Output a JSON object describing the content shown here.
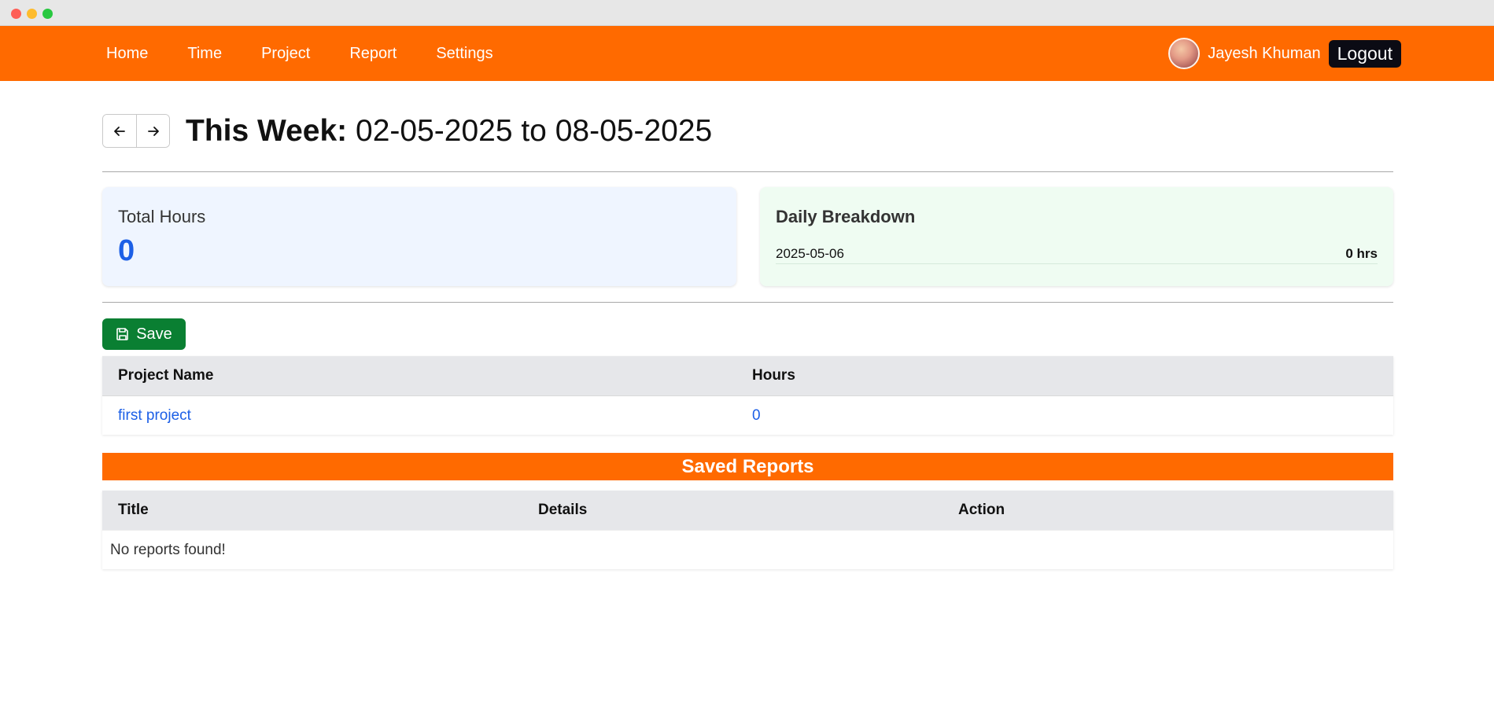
{
  "nav": {
    "links": [
      "Home",
      "Time",
      "Project",
      "Report",
      "Settings"
    ],
    "user_name": "Jayesh Khuman",
    "logout_label": "Logout"
  },
  "week": {
    "label": "This Week:",
    "range": "02-05-2025 to 08-05-2025",
    "prev_icon": "arrow-left-icon",
    "next_icon": "arrow-right-icon"
  },
  "summary": {
    "total_label": "Total Hours",
    "total_value": "0",
    "daily_title": "Daily Breakdown",
    "daily_rows": [
      {
        "date": "2025-05-06",
        "hours": "0 hrs"
      }
    ]
  },
  "projects": {
    "save_label": "Save",
    "save_icon": "floppy-disk-icon",
    "headers": [
      "Project Name",
      "Hours"
    ],
    "rows": [
      {
        "name": "first project",
        "hours": "0"
      }
    ]
  },
  "reports": {
    "title": "Saved Reports",
    "headers": [
      "Title",
      "Details",
      "Action"
    ],
    "empty_text": "No reports found!"
  },
  "colors": {
    "brand": "#ff6a00",
    "accent": "#1c5fe6",
    "save": "#0a7f32"
  }
}
